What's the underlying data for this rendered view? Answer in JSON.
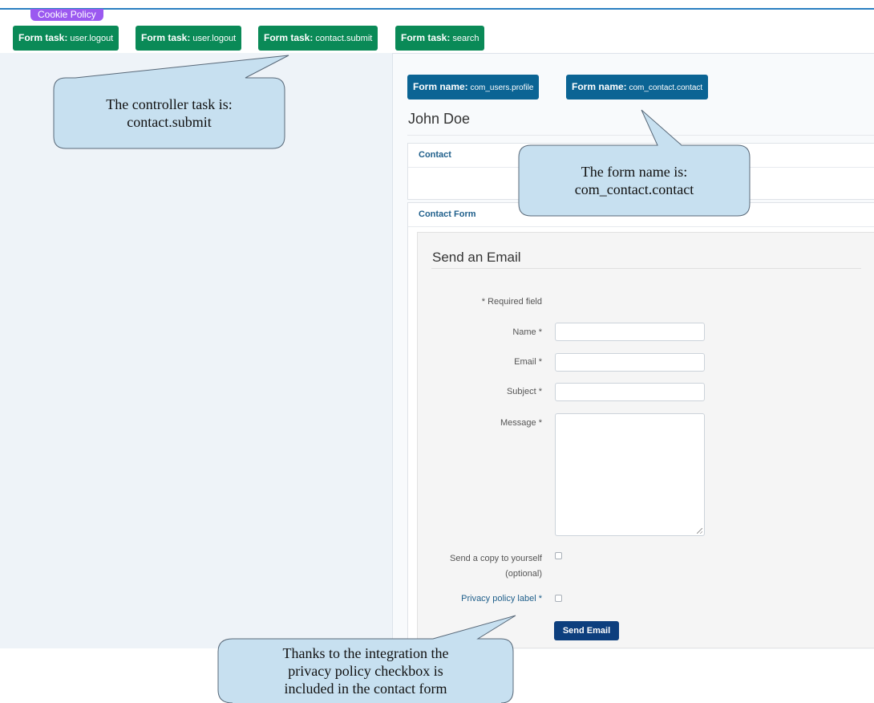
{
  "cookie_badge": "Cookie Policy",
  "task_tabs": [
    {
      "prefix": "Form task:",
      "value": "user.logout"
    },
    {
      "prefix": "Form task:",
      "value": "user.logout"
    },
    {
      "prefix": "Form task:",
      "value": "contact.submit"
    },
    {
      "prefix": "Form task:",
      "value": "search"
    }
  ],
  "form_tabs": [
    {
      "prefix": "Form name:",
      "value": "com_users.profile"
    },
    {
      "prefix": "Form name:",
      "value": "com_contact.contact"
    }
  ],
  "page_title": "John Doe",
  "accordions": {
    "contact": "Contact",
    "contact_form": "Contact Form"
  },
  "form": {
    "legend": "Send an Email",
    "required_note": "* Required field",
    "name_label": "Name *",
    "email_label": "Email *",
    "subject_label": "Subject *",
    "message_label": "Message *",
    "copy_label_1": "Send a copy to yourself",
    "copy_label_2": "(optional)",
    "privacy_label": "Privacy policy label *",
    "submit_label": "Send Email"
  },
  "callouts": {
    "task_1": "The controller task is:",
    "task_2": "contact.submit",
    "form_1": "The form name is:",
    "form_2": "com_contact.contact",
    "privacy_1": "Thanks to the integration the",
    "privacy_2": "privacy policy checkbox is",
    "privacy_3": "included in the contact form"
  },
  "colors": {
    "task_tab": "#0a8a57",
    "form_tab": "#0b6494",
    "callout_fill": "#c7e0f0",
    "button": "#0d3f7e",
    "cookie": "#9b59f0"
  }
}
